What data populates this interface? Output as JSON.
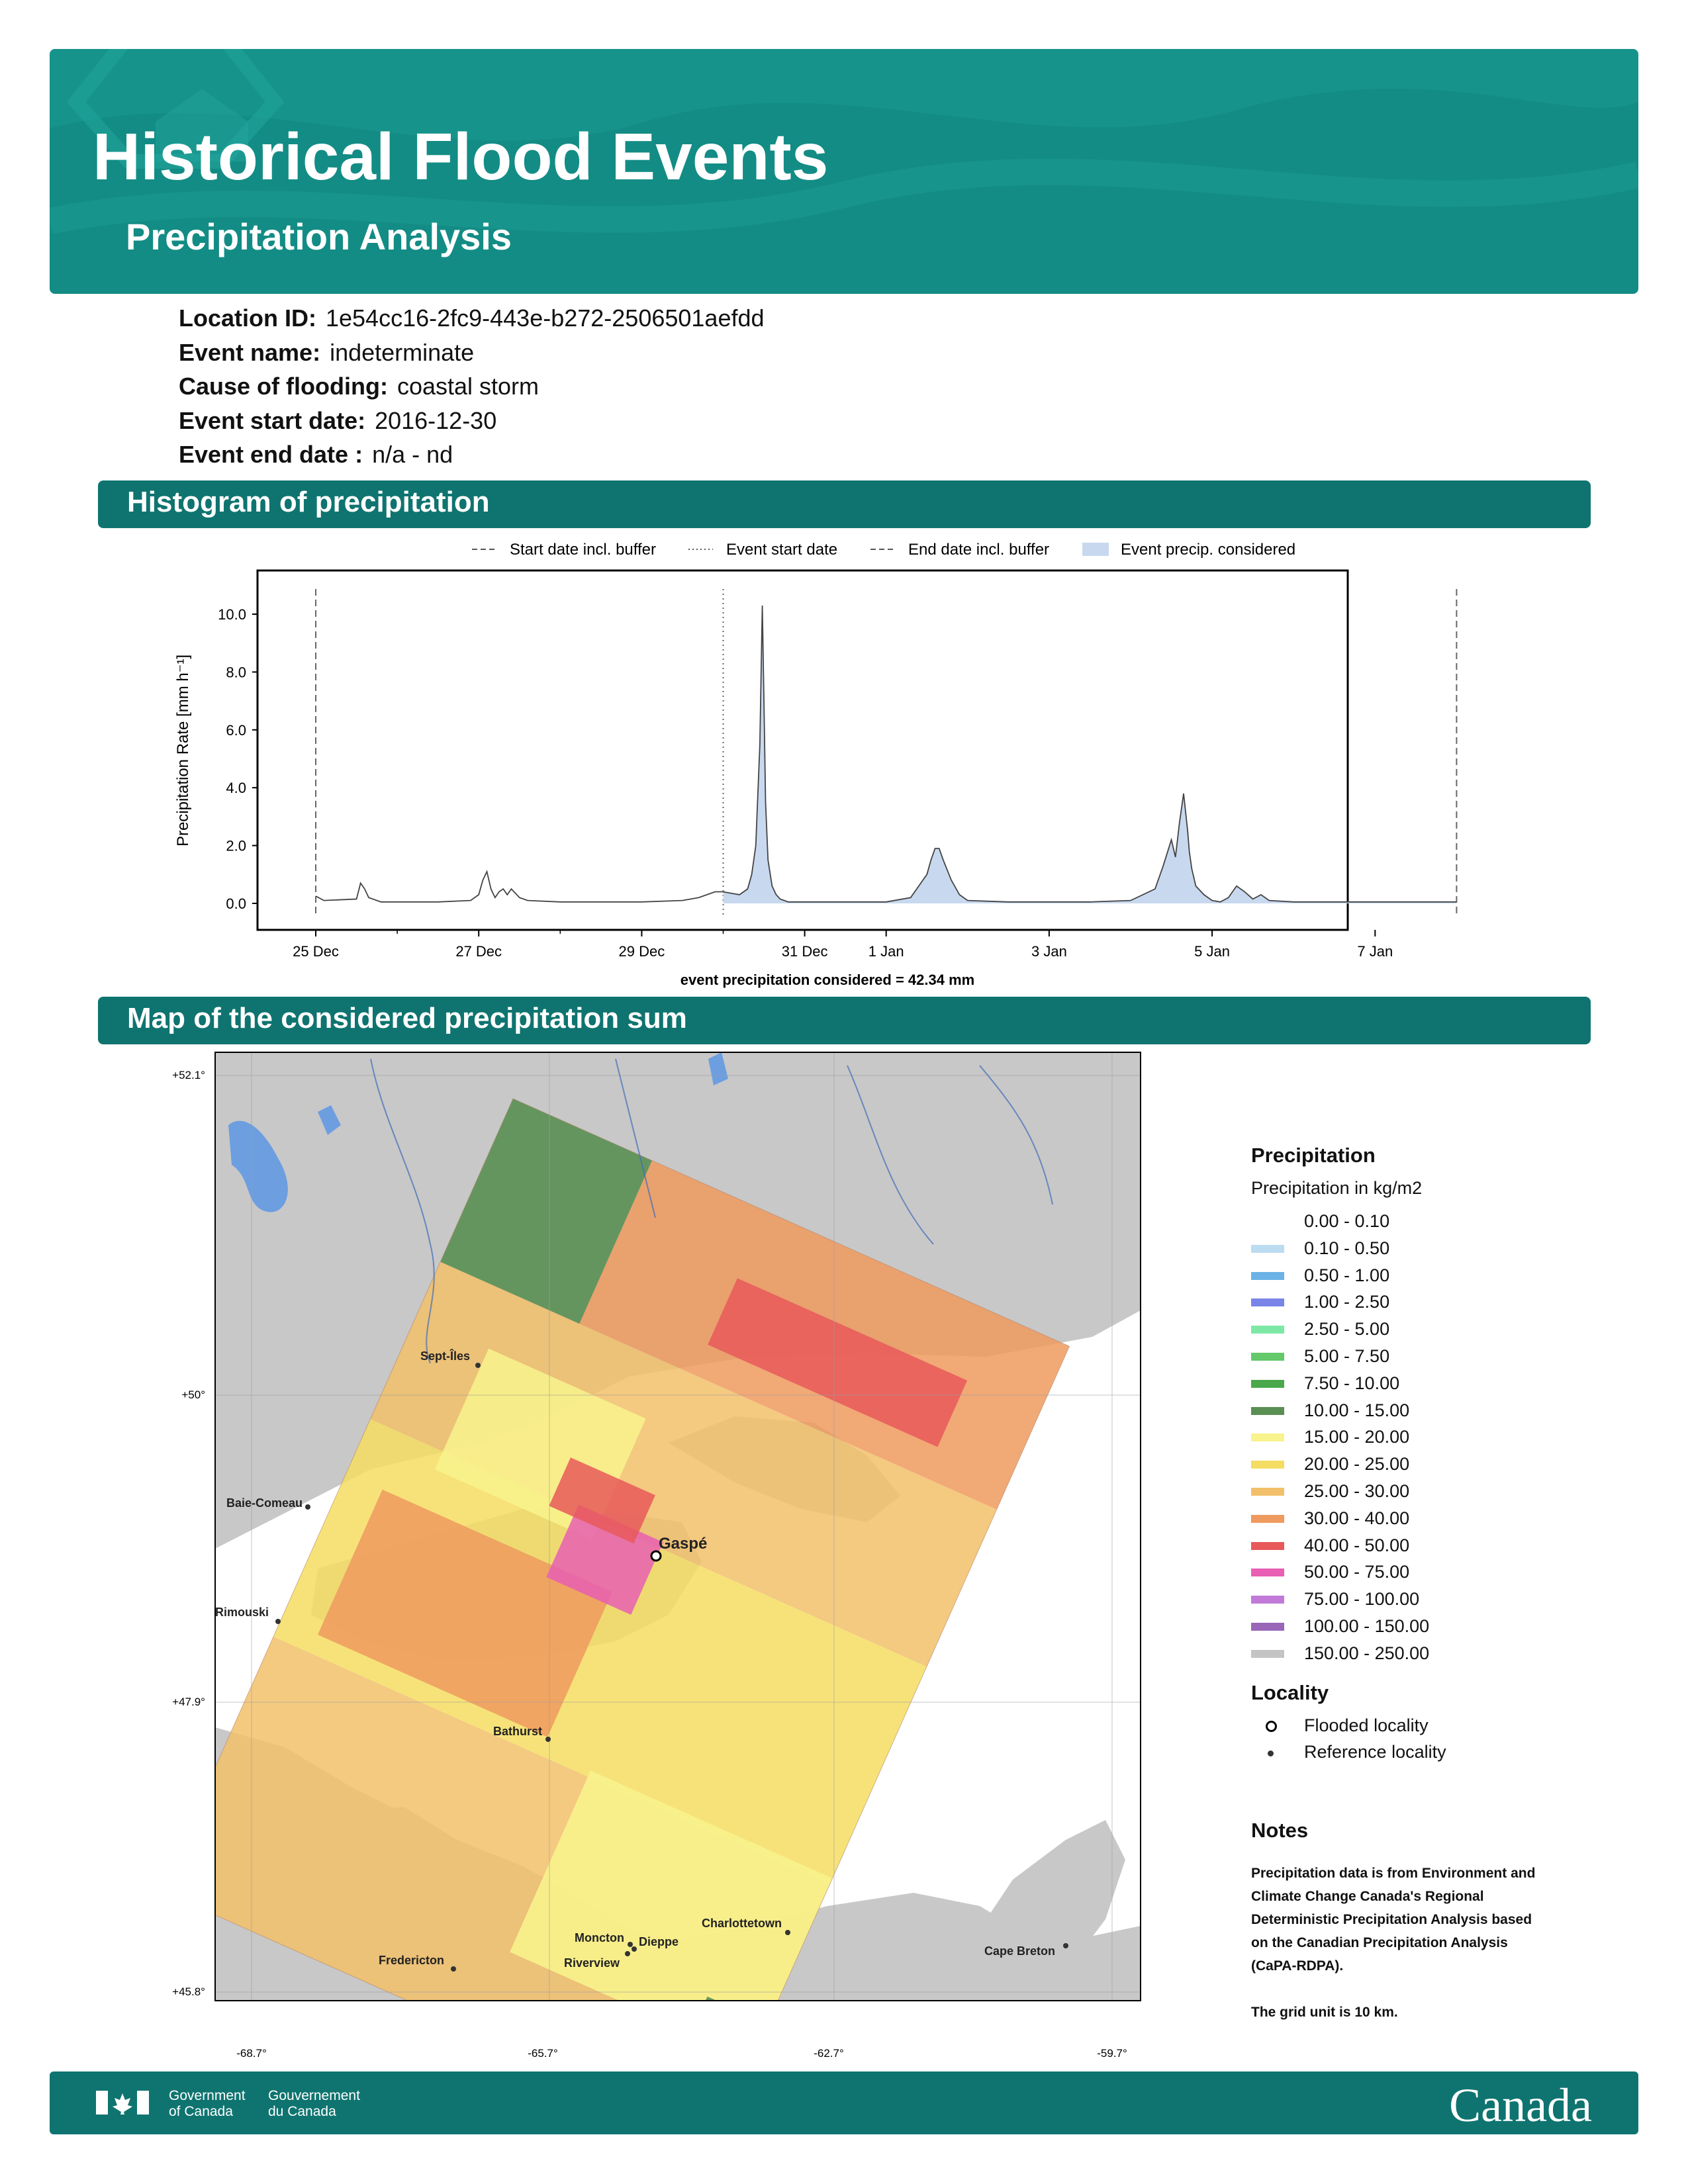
{
  "header": {
    "title": "Historical Flood Events",
    "subtitle": "Precipitation Analysis"
  },
  "event_info": [
    {
      "label": "Location ID:",
      "value": "1e54cc16-2fc9-443e-b272-2506501aefdd"
    },
    {
      "label": "Event name:",
      "value": "indeterminate"
    },
    {
      "label": "Cause of flooding:",
      "value": "coastal storm"
    },
    {
      "label": "Event start date:",
      "value": "2016-12-30"
    },
    {
      "label": "Event end date :",
      "value": "n/a - nd"
    }
  ],
  "sections": {
    "histogram": "Histogram of precipitation",
    "map": "Map of the considered precipitation sum"
  },
  "chart_data": {
    "type": "area",
    "ylabel": "Precipitation Rate [mm h⁻¹]",
    "xlabel": "event precipitation considered = 42.34 mm",
    "ylim": [
      -0.4,
      11.0
    ],
    "yticks": [
      "0.0",
      "2.0",
      "4.0",
      "6.0",
      "8.0",
      "10.0"
    ],
    "xticks": [
      "25 Dec",
      "27 Dec",
      "29 Dec",
      "31 Dec",
      "1 Jan",
      "3 Jan",
      "5 Jan",
      "7 Jan"
    ],
    "xtick_days": [
      0,
      2,
      4,
      6,
      7,
      9,
      11,
      13
    ],
    "legend": [
      {
        "label": "Start date incl. buffer",
        "style": "dashed"
      },
      {
        "label": "Event start date",
        "style": "dotted"
      },
      {
        "label": "End date incl. buffer",
        "style": "dashed"
      },
      {
        "label": "Event precip. considered",
        "style": "fill"
      }
    ],
    "start_buffer_day": 0,
    "event_start_day": 5,
    "end_buffer_day": 14,
    "series": [
      {
        "x": [
          0,
          0.1,
          0.5,
          0.55,
          0.6,
          0.65,
          0.7,
          0.75,
          0.8,
          1.0,
          1.5,
          1.9,
          2.0,
          2.05,
          2.1,
          2.15,
          2.2,
          2.25,
          2.3,
          2.35,
          2.4,
          2.5,
          2.6,
          3.0,
          3.5,
          4.0,
          4.5,
          4.7,
          4.8,
          4.9,
          5.0,
          5.1,
          5.2,
          5.3,
          5.35,
          5.4,
          5.45,
          5.48,
          5.5,
          5.52,
          5.55,
          5.6,
          5.65,
          5.7,
          5.8,
          6.0,
          6.5,
          7.0,
          7.3,
          7.4,
          7.5,
          7.55,
          7.6,
          7.65,
          7.7,
          7.8,
          7.9,
          8.0,
          8.5,
          9.0,
          9.5,
          10.0,
          10.3,
          10.4,
          10.5,
          10.55,
          10.6,
          10.65,
          10.7,
          10.72,
          10.75,
          10.8,
          10.9,
          11.0,
          11.1,
          11.2,
          11.3,
          11.4,
          11.5,
          11.6,
          11.7,
          12.0,
          13.0,
          14.0
        ],
        "y": [
          0.25,
          0.1,
          0.15,
          0.7,
          0.5,
          0.2,
          0.15,
          0.1,
          0.05,
          0.05,
          0.05,
          0.1,
          0.3,
          0.8,
          1.1,
          0.5,
          0.2,
          0.4,
          0.5,
          0.3,
          0.5,
          0.2,
          0.1,
          0.05,
          0.05,
          0.05,
          0.1,
          0.2,
          0.3,
          0.4,
          0.4,
          0.35,
          0.3,
          0.5,
          1.0,
          2.0,
          5.5,
          10.3,
          7.0,
          3.5,
          1.5,
          0.6,
          0.3,
          0.15,
          0.05,
          0.05,
          0.05,
          0.05,
          0.2,
          0.6,
          1.0,
          1.5,
          1.9,
          1.9,
          1.5,
          0.8,
          0.3,
          0.1,
          0.05,
          0.05,
          0.05,
          0.1,
          0.5,
          1.3,
          2.2,
          1.6,
          2.8,
          3.8,
          2.5,
          1.8,
          1.2,
          0.6,
          0.3,
          0.1,
          0.05,
          0.2,
          0.6,
          0.4,
          0.15,
          0.3,
          0.1,
          0.05,
          0.05,
          0.05
        ]
      }
    ]
  },
  "map": {
    "lat_labels": [
      "+52.1°",
      "+50°",
      "+47.9°",
      "+45.8°"
    ],
    "lon_labels": [
      "-68.7°",
      "-65.7°",
      "-62.7°",
      "-59.7°"
    ],
    "places": [
      {
        "name": "Sept-Îles",
        "type": "reference"
      },
      {
        "name": "Baie-Comeau",
        "type": "reference"
      },
      {
        "name": "Rimouski",
        "type": "reference"
      },
      {
        "name": "Gaspé",
        "type": "flooded"
      },
      {
        "name": "Bathurst",
        "type": "reference"
      },
      {
        "name": "Charlottetown",
        "type": "reference"
      },
      {
        "name": "Moncton",
        "type": "reference"
      },
      {
        "name": "Dieppe",
        "type": "reference"
      },
      {
        "name": "Riverview",
        "type": "reference"
      },
      {
        "name": "Fredericton",
        "type": "reference"
      },
      {
        "name": "Cape Breton",
        "type": "reference"
      }
    ]
  },
  "legend": {
    "precip_title": "Precipitation",
    "precip_subtitle": "Precipitation in kg/m2",
    "classes": [
      {
        "label": "0.00 - 0.10",
        "color": "#ffffff"
      },
      {
        "label": "0.10 - 0.50",
        "color": "#bcdcf2"
      },
      {
        "label": "0.50 - 1.00",
        "color": "#6bb3e6"
      },
      {
        "label": "1.00 - 2.50",
        "color": "#7a84e8"
      },
      {
        "label": "2.50 - 5.00",
        "color": "#7de8a6"
      },
      {
        "label": "5.00 - 7.50",
        "color": "#63c96b"
      },
      {
        "label": "7.50 - 10.00",
        "color": "#4aa84a"
      },
      {
        "label": "10.00 - 15.00",
        "color": "#5a8f53"
      },
      {
        "label": "15.00 - 20.00",
        "color": "#f8f38c"
      },
      {
        "label": "20.00 - 25.00",
        "color": "#f4dd62"
      },
      {
        "label": "25.00 - 30.00",
        "color": "#f2c06a"
      },
      {
        "label": "30.00 - 40.00",
        "color": "#ef9a5e"
      },
      {
        "label": "40.00 - 50.00",
        "color": "#e8595a"
      },
      {
        "label": "50.00 - 75.00",
        "color": "#e85fb3"
      },
      {
        "label": "75.00 - 100.00",
        "color": "#c27ad9"
      },
      {
        "label": "100.00 - 150.00",
        "color": "#9966b8"
      },
      {
        "label": "150.00 - 250.00",
        "color": "#c4c4c4"
      }
    ],
    "locality_title": "Locality",
    "flooded_label": "Flooded locality",
    "reference_label": "Reference locality",
    "notes_title": "Notes",
    "notes_lines": [
      "Precipitation data is from Environment and",
      "Climate Change Canada's Regional",
      "Deterministic Precipitation Analysis based",
      "on the Canadian Precipitation Analysis",
      "(CaPA-RDPA)."
    ],
    "grid_note": "The grid unit is 10 km."
  },
  "footer": {
    "gov_en": "Government\nof Canada",
    "gov_fr": "Gouvernement\ndu Canada",
    "wordmark": "Canada",
    "colors": {
      "bar": "#0f7470",
      "flag_red": "#ffffff"
    }
  }
}
